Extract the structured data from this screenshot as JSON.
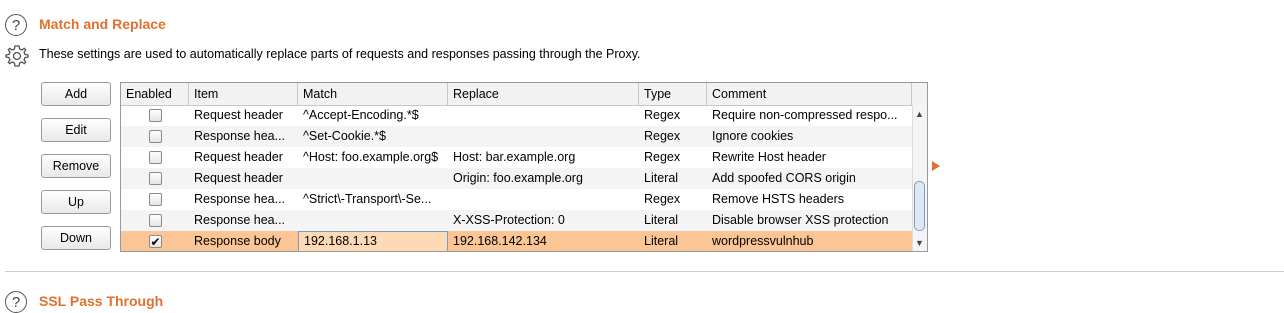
{
  "match_replace": {
    "title": "Match and Replace",
    "description": "These settings are used to automatically replace parts of requests and responses passing through the Proxy.",
    "help_icon": "question-circle-icon",
    "settings_icon": "gear-icon"
  },
  "buttons": {
    "add": "Add",
    "edit": "Edit",
    "remove": "Remove",
    "up": "Up",
    "down": "Down"
  },
  "table": {
    "columns": [
      "Enabled",
      "Item",
      "Match",
      "Replace",
      "Type",
      "Comment"
    ],
    "rows": [
      {
        "enabled": false,
        "item": "Request header",
        "match": "^Accept-Encoding.*$",
        "replace": "",
        "type": "Regex",
        "comment": "Require non-compressed respo..."
      },
      {
        "enabled": false,
        "item": "Response hea...",
        "match": "^Set-Cookie.*$",
        "replace": "",
        "type": "Regex",
        "comment": "Ignore cookies"
      },
      {
        "enabled": false,
        "item": "Request header",
        "match": "^Host: foo.example.org$",
        "replace": "Host: bar.example.org",
        "type": "Regex",
        "comment": "Rewrite Host header"
      },
      {
        "enabled": false,
        "item": "Request header",
        "match": "",
        "replace": "Origin: foo.example.org",
        "type": "Literal",
        "comment": "Add spoofed CORS origin"
      },
      {
        "enabled": false,
        "item": "Response hea...",
        "match": "^Strict\\-Transport\\-Se...",
        "replace": "",
        "type": "Regex",
        "comment": "Remove HSTS headers"
      },
      {
        "enabled": false,
        "item": "Response hea...",
        "match": "",
        "replace": "X-XSS-Protection: 0",
        "type": "Literal",
        "comment": "Disable browser XSS protection"
      },
      {
        "enabled": true,
        "item": "Response body",
        "match": "192.168.1.13",
        "replace": "192.168.142.134",
        "type": "Literal",
        "comment": "wordpressvulnhub",
        "selected": true
      }
    ]
  },
  "scrollbar": {
    "up_icon": "scroll-up-arrow-icon",
    "down_icon": "scroll-down-arrow-icon"
  },
  "ssl": {
    "title": "SSL Pass Through",
    "help_icon": "question-circle-icon"
  },
  "colors": {
    "accent": "#e2702e",
    "selected_row": "#fbc596"
  }
}
